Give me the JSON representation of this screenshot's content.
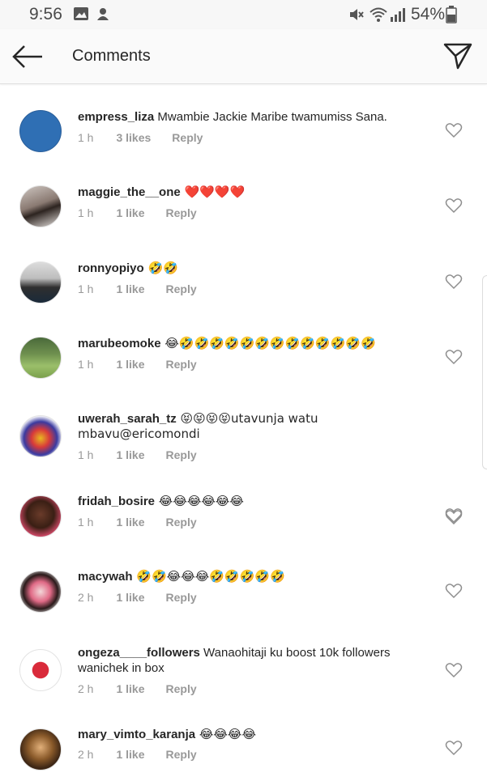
{
  "status_bar": {
    "time": "9:56",
    "battery": "54%",
    "icons": [
      "image-icon",
      "notification-icon",
      "mute-icon",
      "wifi-icon",
      "signal-icon",
      "battery-icon"
    ]
  },
  "header": {
    "title": "Comments",
    "back_icon": "arrow-left-icon",
    "send_icon": "paper-plane-icon"
  },
  "colors": {
    "meta_text": "#999999",
    "header_bg": "#fafafa",
    "status_bg": "#f7f7f7"
  },
  "comments": [
    {
      "username": "empress_liza",
      "text": " Mwambie Jackie Maribe twamumiss Sana.",
      "time": "1 h",
      "likes": "3 likes",
      "reply": "Reply"
    },
    {
      "username": "maggie_the__one",
      "text": " ❤️❤️❤️❤️",
      "time": "1 h",
      "likes": "1 like",
      "reply": "Reply"
    },
    {
      "username": "ronnyopiyo",
      "text": " 🤣🤣",
      "time": "1 h",
      "likes": "1 like",
      "reply": "Reply"
    },
    {
      "username": "marubeomoke",
      "text": " 😂🤣🤣🤣🤣🤣🤣🤣🤣🤣🤣🤣🤣🤣",
      "time": "1 h",
      "likes": "1 like",
      "reply": "Reply"
    },
    {
      "username": "uwerah_sarah_tz",
      "text": " 😝😝😝😝utavunja watu mbavu@ericomondi",
      "time": "1 h",
      "likes": "1 like",
      "reply": "Reply"
    },
    {
      "username": "fridah_bosire",
      "text": " 😂😂😂😂😂😂",
      "time": "1 h",
      "likes": "1 like",
      "reply": "Reply"
    },
    {
      "username": "macywah",
      "text": " 🤣🤣😂😂😂🤣🤣🤣🤣🤣",
      "time": "2 h",
      "likes": "1 like",
      "reply": "Reply"
    },
    {
      "username": "ongeza____followers",
      "text": " Wanaohitaji ku boost 10k followers wanichek in box",
      "time": "2 h",
      "likes": "1 like",
      "reply": "Reply"
    },
    {
      "username": "mary_vimto_karanja",
      "text": " 😂😂😂😂",
      "time": "2 h",
      "likes": "1 like",
      "reply": "Reply"
    }
  ]
}
